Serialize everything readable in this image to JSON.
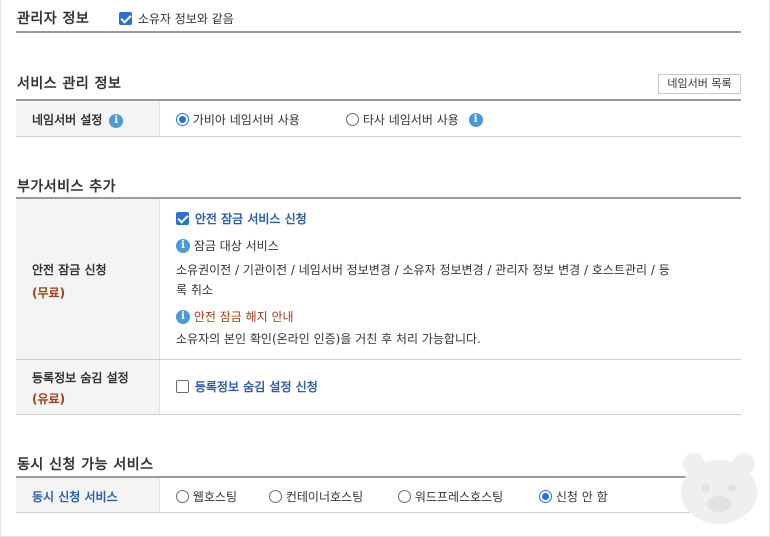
{
  "admin": {
    "title": "관리자 정보",
    "same_as_owner": "소유자 정보와 같음"
  },
  "service_mgmt": {
    "title": "서비스 관리 정보",
    "ns_list_button": "네임서버 목록",
    "ns_setting_label": "네임서버 설정",
    "options": [
      "가비아 네임서버 사용",
      "타사 네임서버 사용"
    ],
    "selected": 0
  },
  "addon": {
    "title": "부가서비스 추가",
    "safe_lock_label": "안전 잠금 신청",
    "safe_lock_price": "(무료)",
    "safe_lock_checkbox": "안전 잠금 서비스 신청",
    "lock_target_title": "잠금 대상 서비스",
    "lock_target_line1": "소유권이전 / 기관이전 / 네임서버 정보변경 / 소유자 정보변경 / 관리자 정보 변경 / 호스트관리 / 등",
    "lock_target_line2": "록 취소",
    "unlock_title": "안전 잠금 해지 안내",
    "unlock_desc": "소유자의 본인 확인(온라인 인증)을 거친 후 처리 가능합니다.",
    "hide_label": "등록정보 숨김 설정",
    "hide_price": "(유료)",
    "hide_checkbox": "등록정보 숨김 설정 신청"
  },
  "concurrent": {
    "title": "동시 신청 가능 서비스",
    "label": "동시 신청 서비스",
    "options": [
      "웹호스팅",
      "컨테이너호스팅",
      "워드프레스호스팅",
      "신청 안 함"
    ],
    "selected": 3
  }
}
